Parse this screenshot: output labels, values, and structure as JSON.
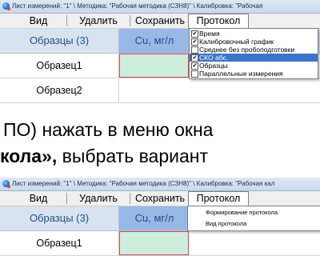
{
  "screen1": {
    "title": "Лист измерений: \"1\" \\ Методика: \"Рабочая методика (СЗН8)\" \\ Калибровка: \"Рабочая",
    "menu": [
      "Вид",
      "Удалить",
      "Сохранить",
      "Протокол"
    ],
    "header": {
      "samples": "Образцы (3)",
      "cu": "Cu, мг/л"
    },
    "rows": [
      "Образец1",
      "Образец2"
    ],
    "dropdown": [
      {
        "label": "Время",
        "checked": true,
        "highlighted": false
      },
      {
        "label": "Калибровочный график",
        "checked": true,
        "highlighted": false
      },
      {
        "label": "Среднее без пробоподготовки",
        "checked": false,
        "highlighted": false
      },
      {
        "label": "СКО абс.",
        "checked": true,
        "highlighted": true
      },
      {
        "label": "Образцы",
        "checked": true,
        "highlighted": false
      },
      {
        "label": "Параллельные измерения",
        "checked": false,
        "highlighted": false
      }
    ]
  },
  "doc": {
    "line1": "ПО) нажать в меню окна",
    "line2_bold": "кола»,",
    "line2_rest": " выбрать вариант"
  },
  "screen2": {
    "title": "Лист измерений: \"1\" \\ Методика: \"Рабочая методика (СЗН8)\" \\ Калибровка: \"Рабочая кал",
    "menu": [
      "Вид",
      "Удалить",
      "Сохранить",
      "Протокол"
    ],
    "header": {
      "samples": "Образцы (3)",
      "cu": "Cu, мг/л"
    },
    "rows": [
      "Образец1"
    ],
    "dropdown": [
      "Формирование протокола",
      "Вид протокола"
    ]
  }
}
